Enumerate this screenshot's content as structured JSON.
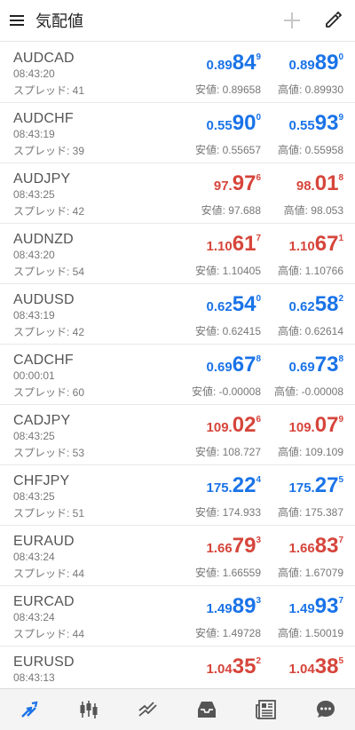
{
  "header": {
    "title": "気配値"
  },
  "colors": {
    "up": "#1a73e8",
    "down": "#d6453b"
  },
  "quotes": [
    {
      "symbol": "AUDCAD",
      "time": "08:43:20",
      "spread": "スプレッド: 41",
      "color": "blue",
      "bid_small": "0.89",
      "bid_big": "84",
      "bid_sup": "9",
      "ask_small": "0.89",
      "ask_big": "89",
      "ask_sup": "0",
      "low": "安値: 0.89658",
      "high": "高値: 0.89930"
    },
    {
      "symbol": "AUDCHF",
      "time": "08:43:19",
      "spread": "スプレッド: 39",
      "color": "blue",
      "bid_small": "0.55",
      "bid_big": "90",
      "bid_sup": "0",
      "ask_small": "0.55",
      "ask_big": "93",
      "ask_sup": "9",
      "low": "安値: 0.55657",
      "high": "高値: 0.55958"
    },
    {
      "symbol": "AUDJPY",
      "time": "08:43:25",
      "spread": "スプレッド: 42",
      "color": "red",
      "bid_small": "97.",
      "bid_big": "97",
      "bid_sup": "6",
      "ask_small": "98.",
      "ask_big": "01",
      "ask_sup": "8",
      "low": "安値: 97.688",
      "high": "高値: 98.053"
    },
    {
      "symbol": "AUDNZD",
      "time": "08:43:20",
      "spread": "スプレッド: 54",
      "color": "red",
      "bid_small": "1.10",
      "bid_big": "61",
      "bid_sup": "7",
      "ask_small": "1.10",
      "ask_big": "67",
      "ask_sup": "1",
      "low": "安値: 1.10405",
      "high": "高値: 1.10766"
    },
    {
      "symbol": "AUDUSD",
      "time": "08:43:19",
      "spread": "スプレッド: 42",
      "color": "blue",
      "bid_small": "0.62",
      "bid_big": "54",
      "bid_sup": "0",
      "ask_small": "0.62",
      "ask_big": "58",
      "ask_sup": "2",
      "low": "安値: 0.62415",
      "high": "高値: 0.62614"
    },
    {
      "symbol": "CADCHF",
      "time": "00:00:01",
      "spread": "スプレッド: 60",
      "color": "blue",
      "bid_small": "0.69",
      "bid_big": "67",
      "bid_sup": "8",
      "ask_small": "0.69",
      "ask_big": "73",
      "ask_sup": "8",
      "low": "安値: -0.00008",
      "high": "高値: -0.00008"
    },
    {
      "symbol": "CADJPY",
      "time": "08:43:25",
      "spread": "スプレッド: 53",
      "color": "red",
      "bid_small": "109.",
      "bid_big": "02",
      "bid_sup": "6",
      "ask_small": "109.",
      "ask_big": "07",
      "ask_sup": "9",
      "low": "安値: 108.727",
      "high": "高値: 109.109"
    },
    {
      "symbol": "CHFJPY",
      "time": "08:43:25",
      "spread": "スプレッド: 51",
      "color": "blue",
      "bid_small": "175.",
      "bid_big": "22",
      "bid_sup": "4",
      "ask_small": "175.",
      "ask_big": "27",
      "ask_sup": "5",
      "low": "安値: 174.933",
      "high": "高値: 175.387"
    },
    {
      "symbol": "EURAUD",
      "time": "08:43:24",
      "spread": "スプレッド: 44",
      "color": "red",
      "bid_small": "1.66",
      "bid_big": "79",
      "bid_sup": "3",
      "ask_small": "1.66",
      "ask_big": "83",
      "ask_sup": "7",
      "low": "安値: 1.66559",
      "high": "高値: 1.67079"
    },
    {
      "symbol": "EURCAD",
      "time": "08:43:24",
      "spread": "スプレッド: 44",
      "color": "blue",
      "bid_small": "1.49",
      "bid_big": "89",
      "bid_sup": "3",
      "ask_small": "1.49",
      "ask_big": "93",
      "ask_sup": "7",
      "low": "安値: 1.49728",
      "high": "高値: 1.50019"
    },
    {
      "symbol": "EURUSD",
      "time": "08:43:13",
      "spread": "",
      "color": "red",
      "bid_small": "1.04",
      "bid_big": "35",
      "bid_sup": "2",
      "ask_small": "1.04",
      "ask_big": "38",
      "ask_sup": "5",
      "low": "",
      "high": ""
    }
  ],
  "nav": [
    {
      "name": "nav-quotes",
      "icon": "quotes-arrows-icon"
    },
    {
      "name": "nav-chart",
      "icon": "candlestick-icon"
    },
    {
      "name": "nav-trade",
      "icon": "trade-trend-icon"
    },
    {
      "name": "nav-history",
      "icon": "inbox-tray-icon"
    },
    {
      "name": "nav-news",
      "icon": "newspaper-icon"
    },
    {
      "name": "nav-chat",
      "icon": "chat-bubble-icon"
    }
  ]
}
